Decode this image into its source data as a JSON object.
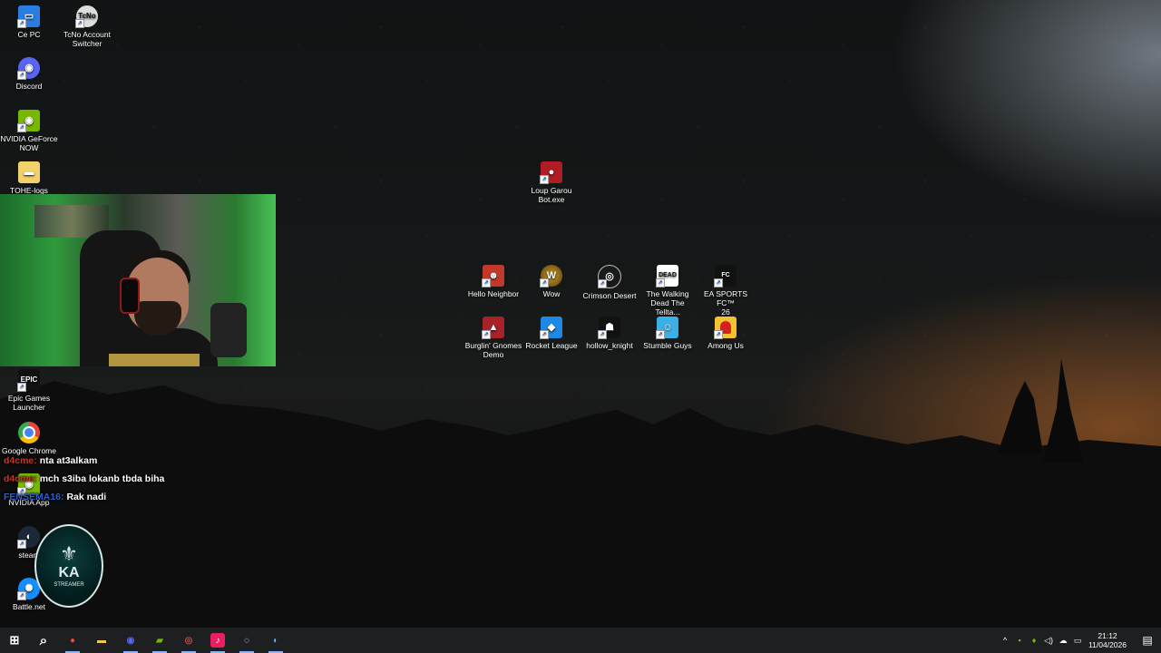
{
  "desktop": {
    "left_icons": [
      {
        "label": "Ce PC",
        "icon": "computer-icon"
      },
      {
        "label": "TcNo Account\nSwitcher",
        "icon": "tcno-icon"
      },
      {
        "label": "Discord",
        "icon": "discord-icon"
      },
      {
        "label": "NVIDIA GeForce\nNOW",
        "icon": "nvidia-icon"
      },
      {
        "label": "TOHE-logs",
        "icon": "folder-icon"
      },
      {
        "label": "Epic Games\nLauncher",
        "icon": "epic-icon"
      },
      {
        "label": "Google Chrome",
        "icon": "chrome-icon"
      },
      {
        "label": "NVIDIA App",
        "icon": "nvidia-app-icon"
      },
      {
        "label": "steam",
        "icon": "steam-icon"
      },
      {
        "label": "Battle.net",
        "icon": "battlenet-icon"
      }
    ],
    "center_icons": [
      {
        "label": "Loup Garou\nBot.exe",
        "icon": "loup-garou-icon"
      },
      {
        "label": "Hello Neighbor",
        "icon": "hello-neighbor-icon"
      },
      {
        "label": "Wow",
        "icon": "wow-icon"
      },
      {
        "label": "Crimson Desert",
        "icon": "crimson-desert-icon"
      },
      {
        "label": "The Walking\nDead The Tellta...",
        "icon": "walking-dead-icon"
      },
      {
        "label": "EA SPORTS FC™\n26",
        "icon": "ea-fc-icon"
      },
      {
        "label": "Burglin' Gnomes\nDemo",
        "icon": "burglin-gnomes-icon"
      },
      {
        "label": "Rocket League",
        "icon": "rocket-league-icon"
      },
      {
        "label": "hollow_knight",
        "icon": "hollow-knight-icon"
      },
      {
        "label": "Stumble Guys",
        "icon": "stumble-guys-icon"
      },
      {
        "label": "Among Us",
        "icon": "among-us-icon"
      }
    ]
  },
  "chat": [
    {
      "user": "d4cme:",
      "message": "nta at3alkam"
    },
    {
      "user": "d4cme:",
      "message": "mch s3iba lokanb tbda biha"
    },
    {
      "user": "FENSEMA16:",
      "message": "Rak nadi"
    }
  ],
  "logo": {
    "glyph": "⚜",
    "text": "KA",
    "tag": "STREAMER"
  },
  "taskbar": {
    "apps": [
      {
        "name": "start-button",
        "glyph": "⊞",
        "color": "#ffffff"
      },
      {
        "name": "search-button",
        "glyph": "⌕",
        "color": "#ffffff"
      },
      {
        "name": "taskbar-chrome",
        "glyph": "●",
        "color": "#e8453c"
      },
      {
        "name": "taskbar-explorer",
        "glyph": "▬",
        "color": "#f2c744"
      },
      {
        "name": "taskbar-discord",
        "glyph": "◉",
        "color": "#5865f2"
      },
      {
        "name": "taskbar-nvidia",
        "glyph": "▰",
        "color": "#2a2a2a"
      },
      {
        "name": "taskbar-obs",
        "glyph": "◎",
        "color": "#3a3a3a"
      },
      {
        "name": "taskbar-tiktok",
        "glyph": "♪",
        "color": "#e91e63"
      },
      {
        "name": "taskbar-tcno",
        "glyph": "◌",
        "color": "#3a3a3a"
      },
      {
        "name": "taskbar-steam",
        "glyph": "◐",
        "color": "#1b6ac9"
      }
    ],
    "tray": [
      "^",
      "▪",
      "♦",
      "◁)",
      "☁",
      "▭"
    ],
    "time": "21:12",
    "date": "11/04/2026",
    "notification_glyph": "▤"
  }
}
